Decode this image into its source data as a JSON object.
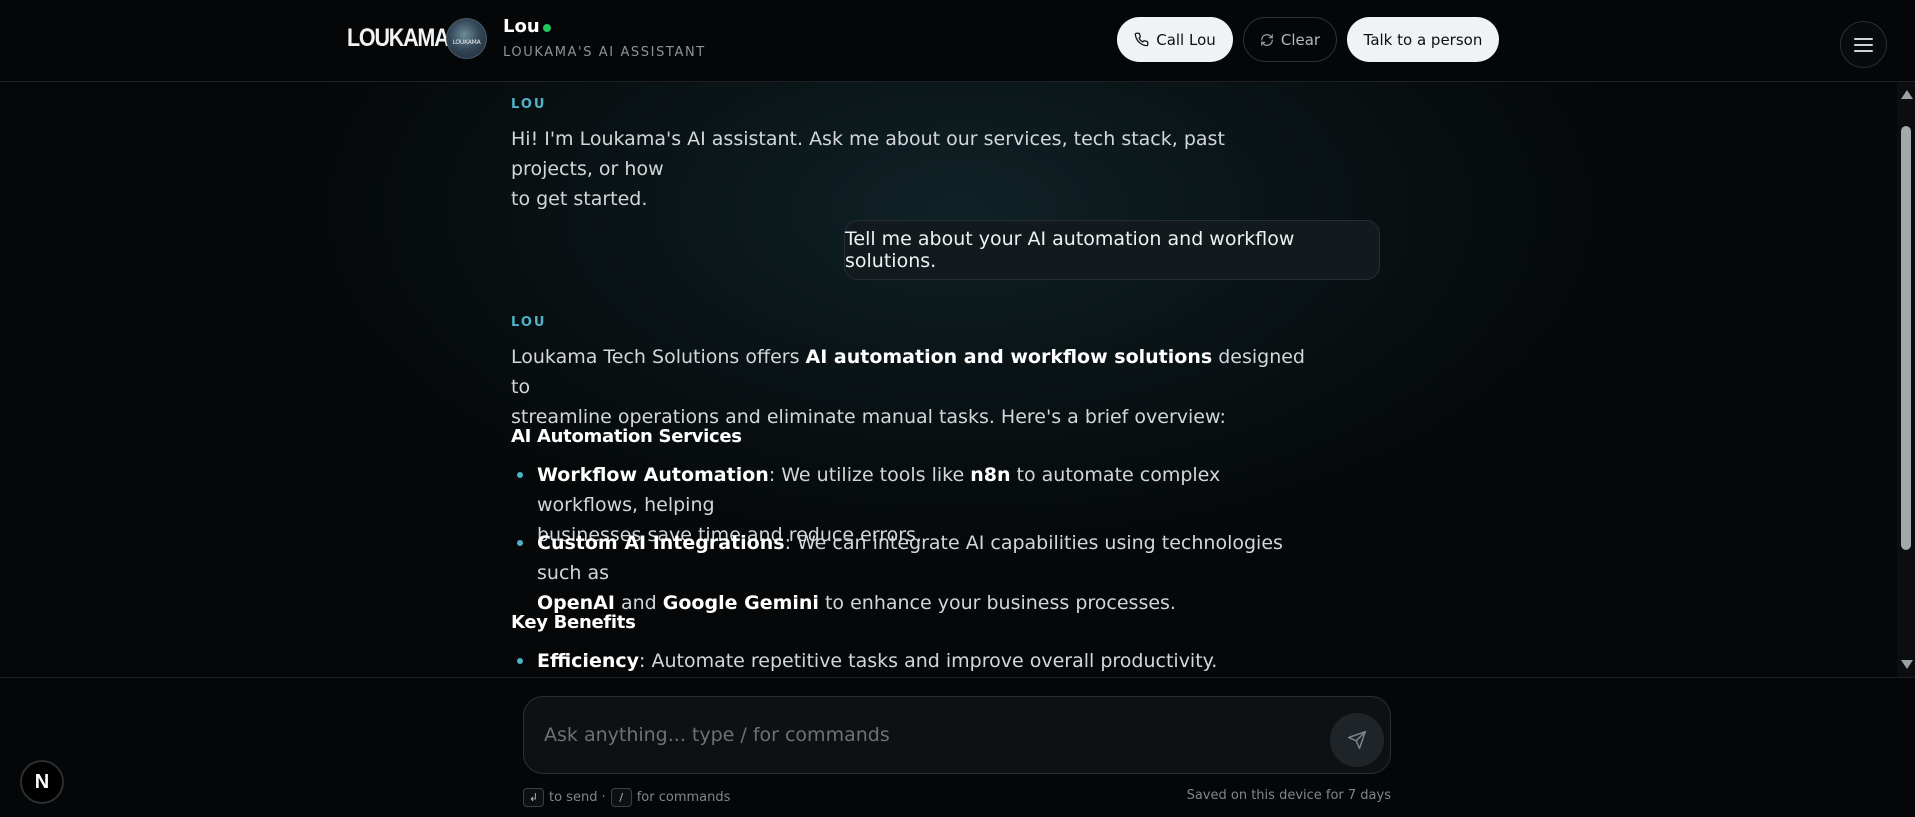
{
  "header": {
    "logo": "LOUKAMA",
    "avatar_text": "LOUKAMA",
    "bot_name": "Lou",
    "bot_subtitle": "LOUKAMA'S AI ASSISTANT",
    "call_label": "Call Lou",
    "clear_label": "Clear",
    "person_label": "Talk to a person"
  },
  "chat": {
    "msg1": {
      "sender": "LOU",
      "line1": "Hi! I'm Loukama's AI assistant. Ask me about our services, tech stack, past projects, or how",
      "line2": "to get started."
    },
    "user_msg": "Tell me about your AI automation and workflow solutions.",
    "msg2": {
      "sender": "LOU",
      "intro_a": "Loukama Tech Solutions offers ",
      "intro_bold": "AI automation and workflow solutions",
      "intro_b": " designed to",
      "intro_line2": "streamline operations and eliminate manual tasks. Here's a brief overview:",
      "heading1": "AI Automation Services",
      "bullet1": {
        "title": "Workflow Automation",
        "text_a": ": We utilize tools like ",
        "bold": "n8n",
        "text_b": " to automate complex workflows, helping",
        "line2": "businesses save time and reduce errors."
      },
      "bullet2": {
        "title": "Custom AI Integrations",
        "text_a": ": We can integrate AI capabilities using technologies such as",
        "bold1": "OpenAI",
        "mid": " and ",
        "bold2": "Google Gemini",
        "text_b": " to enhance your business processes."
      },
      "heading2": "Key Benefits",
      "bullet3": {
        "title": "Efficiency",
        "text": ": Automate repetitive tasks and improve overall productivity."
      }
    }
  },
  "composer": {
    "placeholder": "Ask anything... type / for commands",
    "enter_key": "↲",
    "send_hint": "to send ·",
    "slash_key": "/",
    "commands_hint": "for commands",
    "saved_note": "Saved on this device for 7 days"
  },
  "badge": {
    "letter": "N"
  },
  "colors": {
    "accent": "#4fb3c8",
    "online": "#22c55e",
    "background": "#050708"
  }
}
